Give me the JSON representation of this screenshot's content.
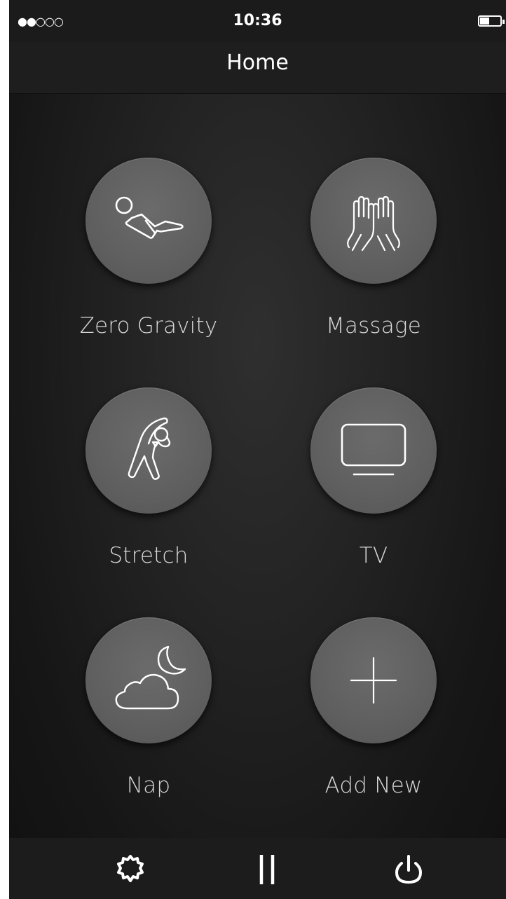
{
  "status_bar": {
    "signal": "●●○○○",
    "time": "10:36",
    "battery_icon": "battery-icon"
  },
  "header": {
    "title": "Home"
  },
  "tiles": [
    {
      "label": "Zero Gravity",
      "icon": "zero-gravity-icon"
    },
    {
      "label": "Massage",
      "icon": "massage-hands-icon"
    },
    {
      "label": "Stretch",
      "icon": "stretch-figure-icon"
    },
    {
      "label": "TV",
      "icon": "tv-icon"
    },
    {
      "label": "Nap",
      "icon": "cloud-moon-icon"
    },
    {
      "label": "Add New",
      "icon": "plus-icon"
    }
  ],
  "tab_bar": {
    "items": [
      {
        "icon": "gear-icon"
      },
      {
        "icon": "pause-icon"
      },
      {
        "icon": "power-icon"
      }
    ]
  },
  "colors": {
    "background": "#1a1a1a",
    "button": "#606060",
    "icon_stroke": "#ffffff",
    "label": "#d8d8d8"
  }
}
